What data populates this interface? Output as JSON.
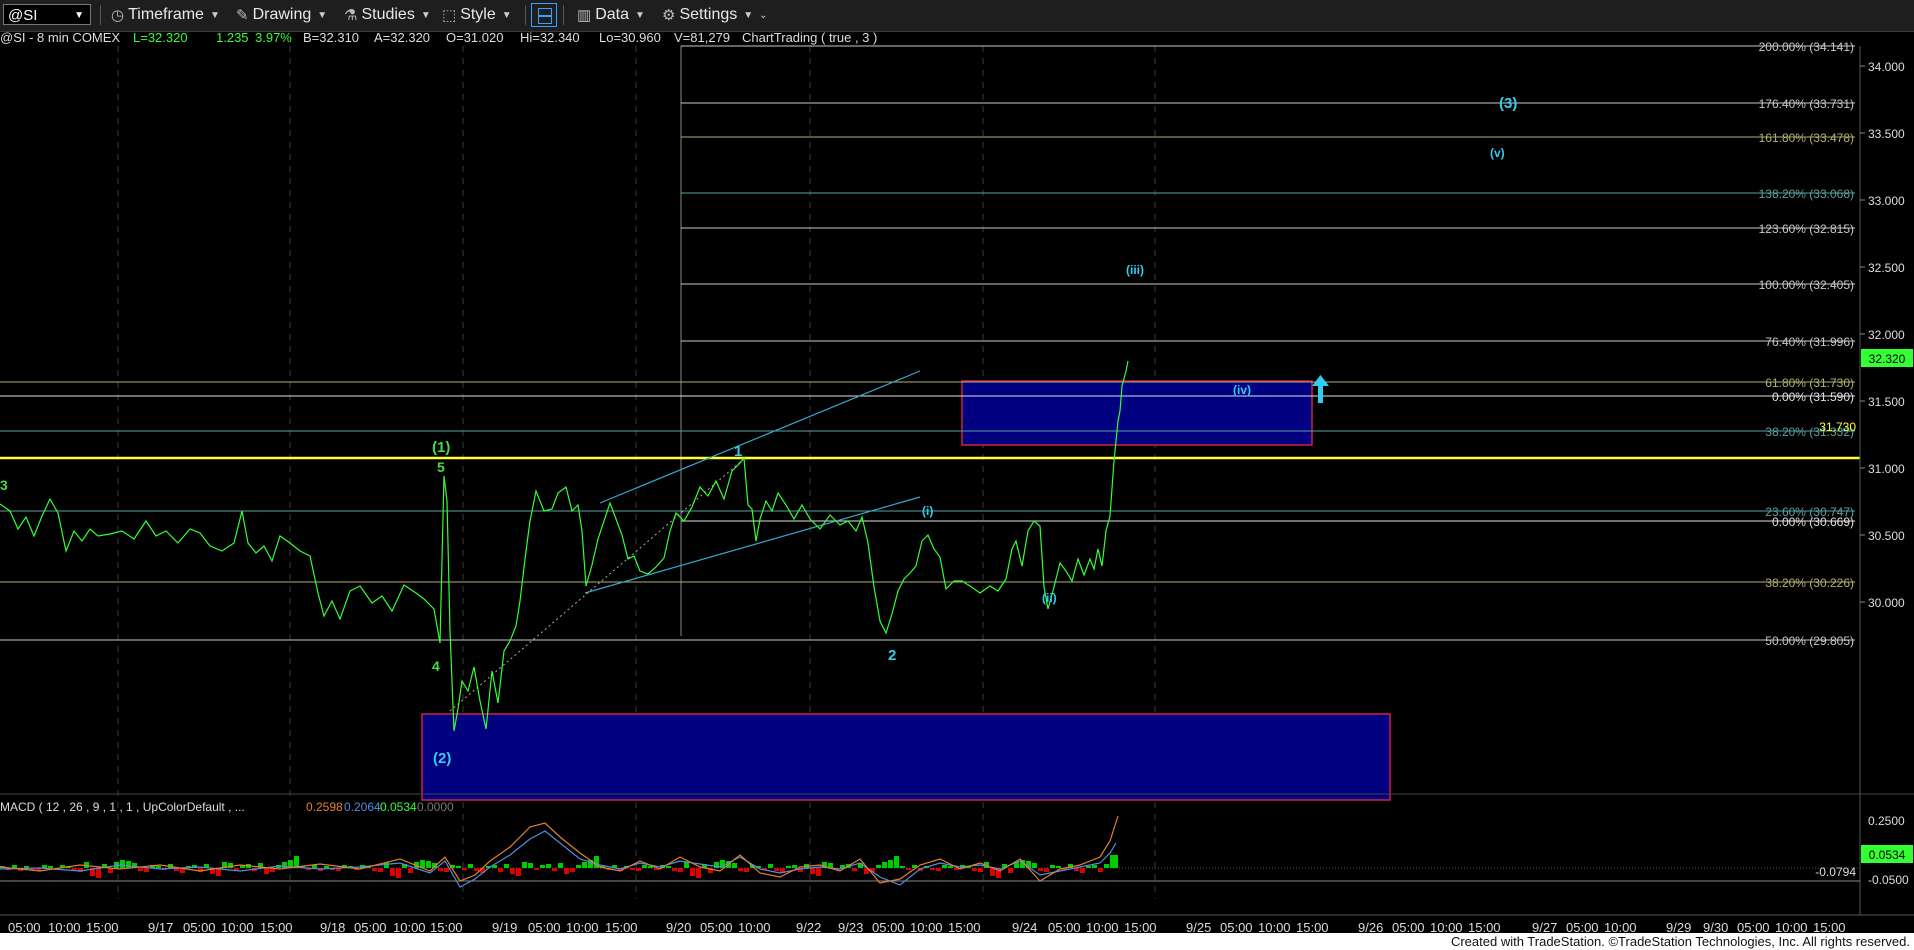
{
  "toolbar": {
    "symbol": "@SI",
    "timeframe": "Timeframe",
    "drawing": "Drawing",
    "studies": "Studies",
    "style": "Style",
    "data": "Data",
    "settings": "Settings"
  },
  "header": {
    "symbol_label": "@SI - 8 min  COMEX",
    "last": "L=32.320",
    "change": "1.235",
    "change_pct": "3.97%",
    "bid": "B=32.310",
    "ask": "A=32.320",
    "open": "O=31.020",
    "high": "Hi=32.340",
    "low": "Lo=30.960",
    "volume": "V=81,279",
    "study": "ChartTrading ( true , 3 )"
  },
  "price_axis": {
    "ticks": [
      "34.000",
      "33.500",
      "33.000",
      "32.500",
      "32.000",
      "31.500",
      "31.000",
      "30.500",
      "30.000"
    ],
    "last_price": "32.320",
    "yellow_level": "31.730"
  },
  "fib_levels": [
    {
      "label": "200.00% (34.141)",
      "color": "#c8c8c8"
    },
    {
      "label": "176.40% (33.731)",
      "color": "#c8c8c8"
    },
    {
      "label": "161.80% (33.478)",
      "color": "#b0b070"
    },
    {
      "label": "138.20% (33.068)",
      "color": "#5aa0a0"
    },
    {
      "label": "123.60% (32.815)",
      "color": "#c8c8c8"
    },
    {
      "label": "100.00% (32.405)",
      "color": "#c8c8c8"
    },
    {
      "label": "76.40% (31.996)",
      "color": "#c8c8c8"
    },
    {
      "label": "61.80% (31.730)",
      "color": "#b0b070"
    },
    {
      "label": "0.00% (31.590)",
      "color": "#e0e0e0"
    },
    {
      "label": "38.20% (31.332)",
      "color": "#5aa0a0"
    },
    {
      "label": "23.60% (30.747)",
      "color": "#5aa0a0"
    },
    {
      "label": "0.00% (30.669)",
      "color": "#e0e0e0"
    },
    {
      "label": "38.20% (30.226)",
      "color": "#b0b070"
    },
    {
      "label": "50.00% (29.805)",
      "color": "#c8c8c8"
    }
  ],
  "wave_labels": {
    "w3_left": "3",
    "w5": "5",
    "w1_paren": "(1)",
    "w4": "4",
    "w2_paren": "(2)",
    "w1": "1",
    "w2": "2",
    "wi": "(i)",
    "wii": "(ii)",
    "wiii": "(iii)",
    "wiv": "(iv)",
    "wv": "(v)",
    "w3_paren": "(3)"
  },
  "macd": {
    "label": "MACD ( 12 , 26 , 9 , 1 , 1 , UpColorDefault , ...",
    "v1": "0.2598",
    "v2": "0.2064",
    "v3": "0.0534",
    "v4": "0.0000",
    "ticks": [
      "0.2500",
      "0.0534",
      "-0.0500"
    ],
    "min_label": "-0.0794"
  },
  "time_axis": {
    "labels": [
      "05:00",
      "10:00",
      "15:00",
      "9/17",
      "05:00",
      "10:00",
      "15:00",
      "9/18",
      "05:00",
      "10:00",
      "15:00",
      "9/19",
      "05:00",
      "10:00",
      "15:00",
      "9/20",
      "05:00",
      "10:00",
      "9/22",
      "9/23",
      "05:00",
      "10:00",
      "15:00",
      "9/24",
      "05:00",
      "10:00",
      "15:00",
      "9/25",
      "05:00",
      "10:00",
      "15:00",
      "9/26",
      "05:00",
      "10:00",
      "15:00",
      "9/27",
      "05:00",
      "10:00",
      "9/29",
      "9/30",
      "05:00",
      "10:00",
      "15:00"
    ]
  },
  "footer": {
    "credit": "Created with TradeStation. ©TradeStation Technologies, Inc. All rights reserved."
  },
  "colors": {
    "price_line": "#33ff33",
    "wave_cyan": "#33ccee",
    "wave_green": "#44dd44",
    "box_fill": "#000080",
    "box_border": "#cc2244",
    "yellow_line": "#ffff33",
    "macd_pos": "#00cc00",
    "macd_neg": "#dd0000"
  }
}
